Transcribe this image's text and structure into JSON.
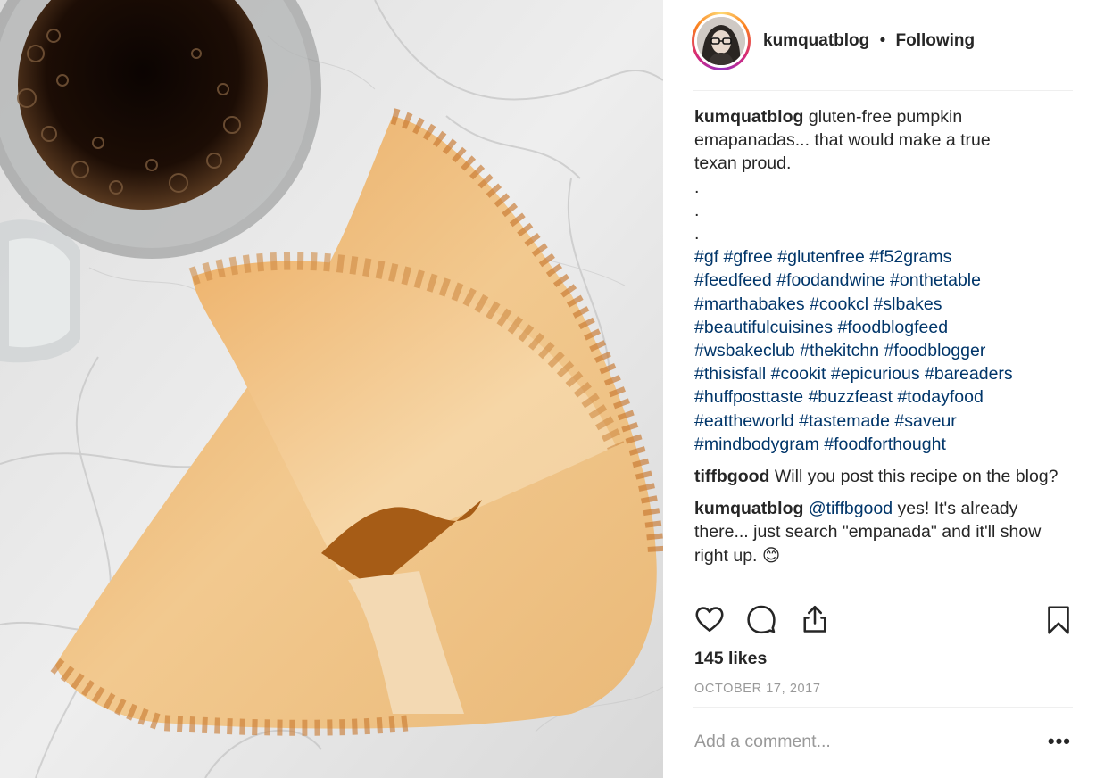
{
  "post": {
    "username": "kumquatblog",
    "separator": "•",
    "follow_status": "Following",
    "image_alt": "gluten-free pumpkin empanadas on marble with a mug of coffee",
    "caption": {
      "username": "kumquatblog",
      "lines": [
        "gluten-free pumpkin",
        "emapanadas... that would make a true",
        "texan proud.",
        ".",
        ".",
        "."
      ],
      "hashtag_lines": [
        [
          "#gf",
          "#gfree",
          "#glutenfree",
          "#f52grams"
        ],
        [
          "#feedfeed",
          "#foodandwine",
          "#onthetable"
        ],
        [
          "#marthabakes",
          "#cookcl",
          "#slbakes"
        ],
        [
          "#beautifulcuisines",
          "#foodblogfeed"
        ],
        [
          "#wsbakeclub",
          "#thekitchn",
          "#foodblogger"
        ],
        [
          "#thisisfall",
          "#cookit",
          "#epicurious",
          "#bareaders"
        ],
        [
          "#huffposttaste",
          "#buzzfeast",
          "#todayfood"
        ],
        [
          "#eattheworld",
          "#tastemade",
          "#saveur"
        ],
        [
          "#mindbodygram",
          "#foodforthought"
        ]
      ]
    },
    "comments": [
      {
        "username": "tiffbgood",
        "text": "Will you post this recipe on the blog?"
      },
      {
        "username": "kumquatblog",
        "mention": "@tiffbgood",
        "text": "yes! It's already there... just search \"empanada\" and it'll show right up.",
        "emoji": "😊"
      }
    ],
    "actions": {
      "like_icon": "heart-icon",
      "comment_icon": "comment-bubble-icon",
      "share_icon": "share-icon",
      "save_icon": "bookmark-icon"
    },
    "likes": "145 likes",
    "date": "OCTOBER 17, 2017",
    "add_comment_placeholder": "Add a comment...",
    "more_label": "•••"
  },
  "colors": {
    "hashtag": "#003569",
    "text": "#262626",
    "muted": "#999999",
    "divider": "#efefef"
  }
}
